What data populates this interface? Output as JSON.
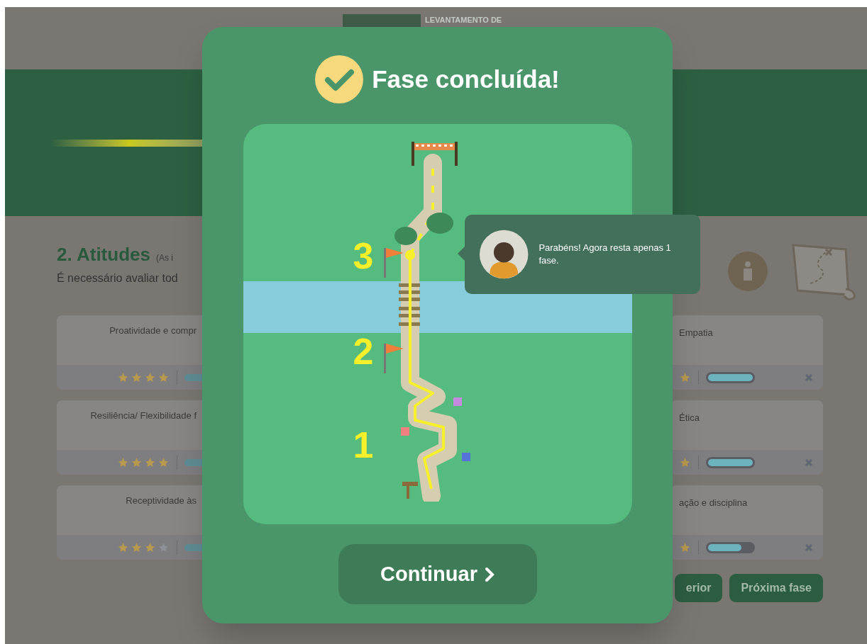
{
  "header": {
    "logo_text": "LEVANTAMENTO DE"
  },
  "section": {
    "title": "2. Atitudes",
    "note": "(As i",
    "subtitle": "É necessário avaliar tod"
  },
  "left_cards": [
    {
      "label": "Proatividade e compr",
      "stars": 4
    },
    {
      "label": "Resiliência/ Flexibilidade f",
      "stars": 4
    },
    {
      "label": "Receptividade às",
      "stars": 3
    }
  ],
  "right_cards": [
    {
      "label": "Empatia",
      "level": 1
    },
    {
      "label": "Ética",
      "level": 1
    },
    {
      "label": "ação e disciplina",
      "level": 0.75
    }
  ],
  "buttons": [
    {
      "label": "erior"
    },
    {
      "label": "Próxima fase"
    }
  ],
  "modal": {
    "title": "Fase concluída!",
    "stages": [
      "3",
      "2",
      "1"
    ],
    "button": "Continuar"
  },
  "tooltip": {
    "text": "Parabéns! Agora resta apenas 1 fase."
  }
}
